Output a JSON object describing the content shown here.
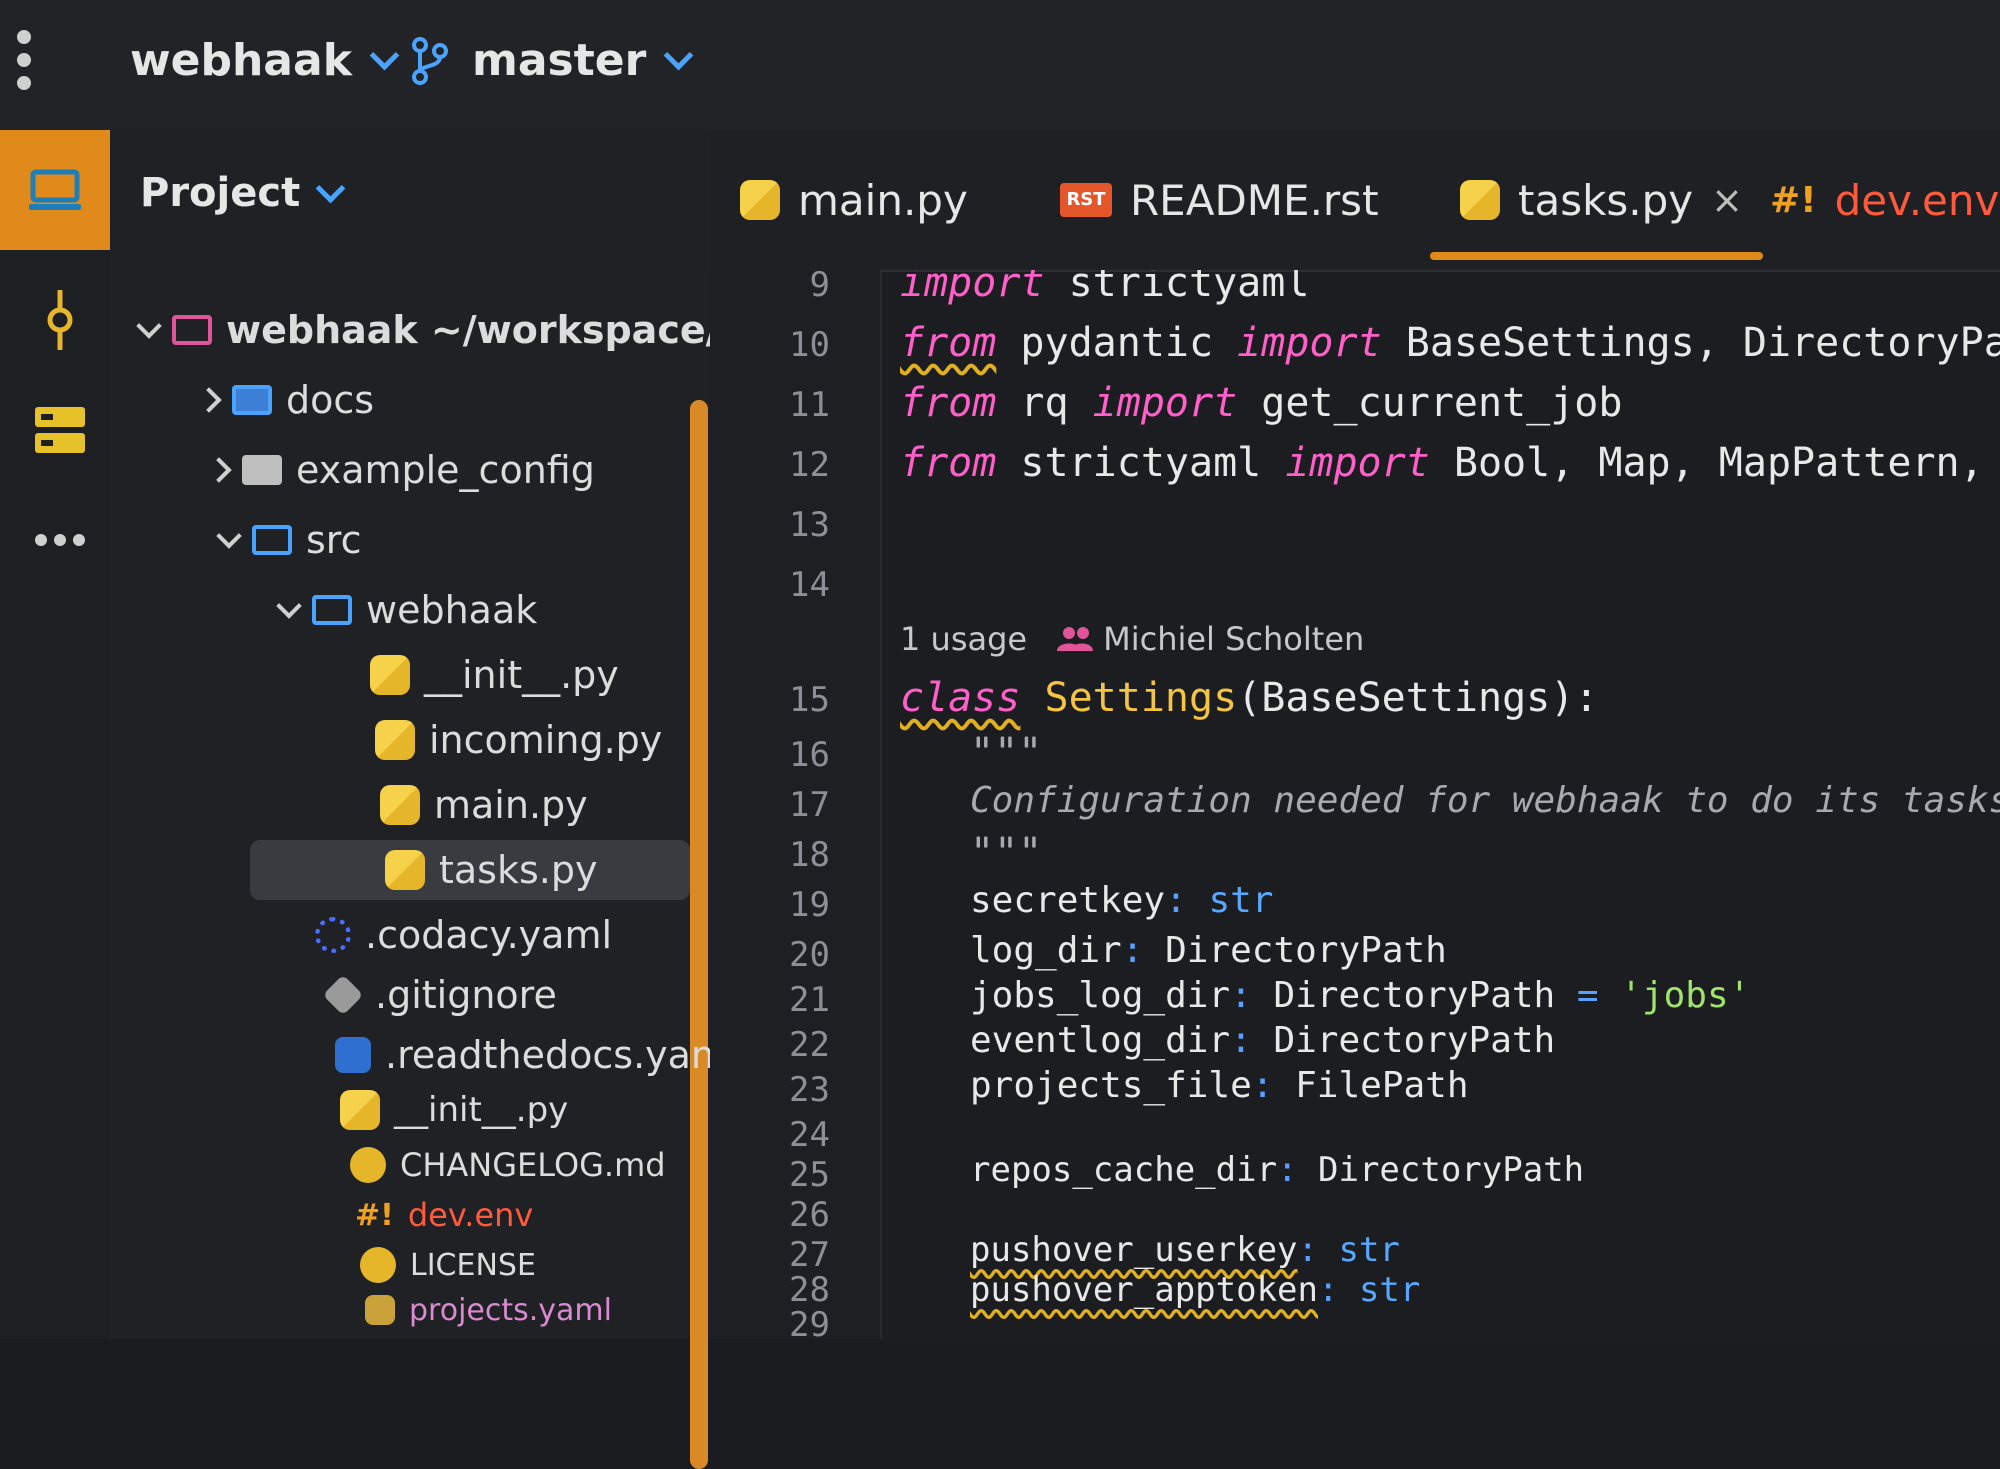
{
  "header": {
    "project_name": "webhaak",
    "branch_name": "master"
  },
  "sidebar": {
    "title": "Project",
    "root_label": "webhaak ~/workspace/pr",
    "items": [
      {
        "label": "docs"
      },
      {
        "label": "example_config"
      },
      {
        "label": "src"
      },
      {
        "label": "webhaak"
      },
      {
        "label": "__init__.py"
      },
      {
        "label": "incoming.py"
      },
      {
        "label": "main.py"
      },
      {
        "label": "tasks.py"
      },
      {
        "label": ".codacy.yaml"
      },
      {
        "label": ".gitignore"
      },
      {
        "label": ".readthedocs.yaml"
      },
      {
        "label": "__init__.py"
      },
      {
        "label": "CHANGELOG.md"
      },
      {
        "label": "dev.env"
      },
      {
        "label": "LICENSE"
      },
      {
        "label": "projects.yaml"
      }
    ]
  },
  "tabs": [
    {
      "label": "main.py"
    },
    {
      "label": "README.rst",
      "icon_text": "RST"
    },
    {
      "label": "tasks.py",
      "close": "×"
    },
    {
      "label": "dev.env",
      "icon_text": "#!"
    }
  ],
  "editor": {
    "line_numbers": [
      "9",
      "10",
      "11",
      "12",
      "13",
      "14",
      "15",
      "16",
      "17",
      "18",
      "19",
      "20",
      "21",
      "22",
      "23",
      "24",
      "25",
      "26",
      "27",
      "28",
      "29"
    ],
    "hint": {
      "usage": "1 usage",
      "author": "Michiel Scholten"
    },
    "code": {
      "l9": {
        "kw": "import",
        "rest": " strictyaml"
      },
      "l10": {
        "kw1": "from",
        "mod": " pydantic ",
        "kw2": "import",
        "names": " BaseSettings, DirectoryPath"
      },
      "l11": {
        "kw1": "from",
        "mod": " rq ",
        "kw2": "import",
        "names": " get_current_job"
      },
      "l12": {
        "kw1": "from",
        "mod": " strictyaml ",
        "kw2": "import",
        "names": " Bool, Map, MapPattern, Opti"
      },
      "l15": {
        "kw": "class",
        "name": " Settings",
        "rest": "(BaseSettings):"
      },
      "l16": "\"\"\"",
      "l17": "Configuration needed for webhaak to do its tasks,",
      "l18": "\"\"\"",
      "l19": {
        "name": "secretkey",
        "sep": ": ",
        "type": "str"
      },
      "l20": {
        "name": "log_dir",
        "sep": ": ",
        "type": "DirectoryPath"
      },
      "l21": {
        "name": "jobs_log_dir",
        "sep": ": ",
        "type": "DirectoryPath",
        "eq": " = ",
        "val": "'jobs'"
      },
      "l22": {
        "name": "eventlog_dir",
        "sep": ": ",
        "type": "DirectoryPath"
      },
      "l23": {
        "name": "projects_file",
        "sep": ": ",
        "type": "FilePath"
      },
      "l25": {
        "name": "repos_cache_dir",
        "sep": ": ",
        "type": "DirectoryPath"
      },
      "l27": {
        "name": "pushover_userkey",
        "sep": ": ",
        "type": "str"
      },
      "l28": {
        "name": "pushover_apptoken",
        "sep": ": ",
        "type": "str"
      }
    }
  },
  "colors": {
    "accent": "#e08a1c",
    "keyword": "#ff5fc8",
    "class_name": "#f5c542",
    "type": "#57a8ff",
    "string": "#9fe36a"
  },
  "icons": [
    "menu-icon",
    "branch-icon",
    "monitor-icon",
    "commit-icon",
    "structure-icon",
    "more-icon",
    "python-icon",
    "rst-icon",
    "env-icon",
    "folder-icon"
  ]
}
